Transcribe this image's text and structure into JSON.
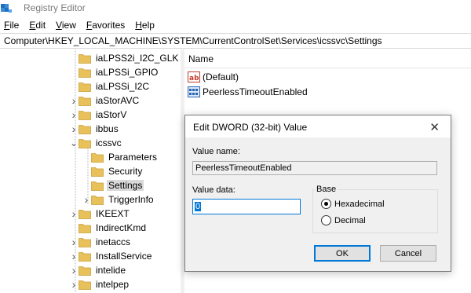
{
  "window": {
    "title": "Registry Editor"
  },
  "menu": [
    {
      "label": "File",
      "mnemonic": "F",
      "rest": "ile"
    },
    {
      "label": "Edit",
      "mnemonic": "E",
      "rest": "dit"
    },
    {
      "label": "View",
      "mnemonic": "V",
      "rest": "iew"
    },
    {
      "label": "Favorites",
      "mnemonic": "F",
      "rest": "avorites"
    },
    {
      "label": "Help",
      "mnemonic": "H",
      "rest": "elp"
    }
  ],
  "address": "Computer\\HKEY_LOCAL_MACHINE\\SYSTEM\\CurrentControlSet\\Services\\icssvc\\Settings",
  "tree": {
    "items": [
      {
        "label": "iaLPSS2i_I2C_GLK",
        "expander": "none"
      },
      {
        "label": "iaLPSSi_GPIO",
        "expander": "none"
      },
      {
        "label": "iaLPSSi_I2C",
        "expander": "none"
      },
      {
        "label": "iaStorAVC",
        "expander": "collapsed"
      },
      {
        "label": "iaStorV",
        "expander": "collapsed"
      },
      {
        "label": "ibbus",
        "expander": "collapsed"
      },
      {
        "label": "icssvc",
        "expander": "expanded"
      },
      {
        "label": "Parameters",
        "expander": "none",
        "child": true
      },
      {
        "label": "Security",
        "expander": "none",
        "child": true
      },
      {
        "label": "Settings",
        "expander": "none",
        "child": true,
        "selected": true
      },
      {
        "label": "TriggerInfo",
        "expander": "collapsed",
        "child": true
      },
      {
        "label": "IKEEXT",
        "expander": "collapsed"
      },
      {
        "label": "IndirectKmd",
        "expander": "none"
      },
      {
        "label": "inetaccs",
        "expander": "collapsed"
      },
      {
        "label": "InstallService",
        "expander": "collapsed"
      },
      {
        "label": "intelide",
        "expander": "collapsed"
      },
      {
        "label": "intelpep",
        "expander": "collapsed"
      }
    ]
  },
  "list": {
    "column_name": "Name",
    "values": [
      {
        "name": "(Default)",
        "icon": "string-value-icon"
      },
      {
        "name": "PeerlessTimeoutEnabled",
        "icon": "dword-value-icon"
      }
    ]
  },
  "dialog": {
    "title": "Edit DWORD (32-bit) Value",
    "close_glyph": "✕",
    "value_name_label": "Value name:",
    "value_name": "PeerlessTimeoutEnabled",
    "value_data_label": "Value data:",
    "value_data": "0",
    "base_label": "Base",
    "radio_hex": "Hexadecimal",
    "radio_dec": "Decimal",
    "base_selected": "Hexadecimal",
    "ok_label": "OK",
    "cancel_label": "Cancel"
  },
  "colors": {
    "accent": "#0078d7",
    "folder": "#e8c15a",
    "selection": "#d9d9d9"
  }
}
